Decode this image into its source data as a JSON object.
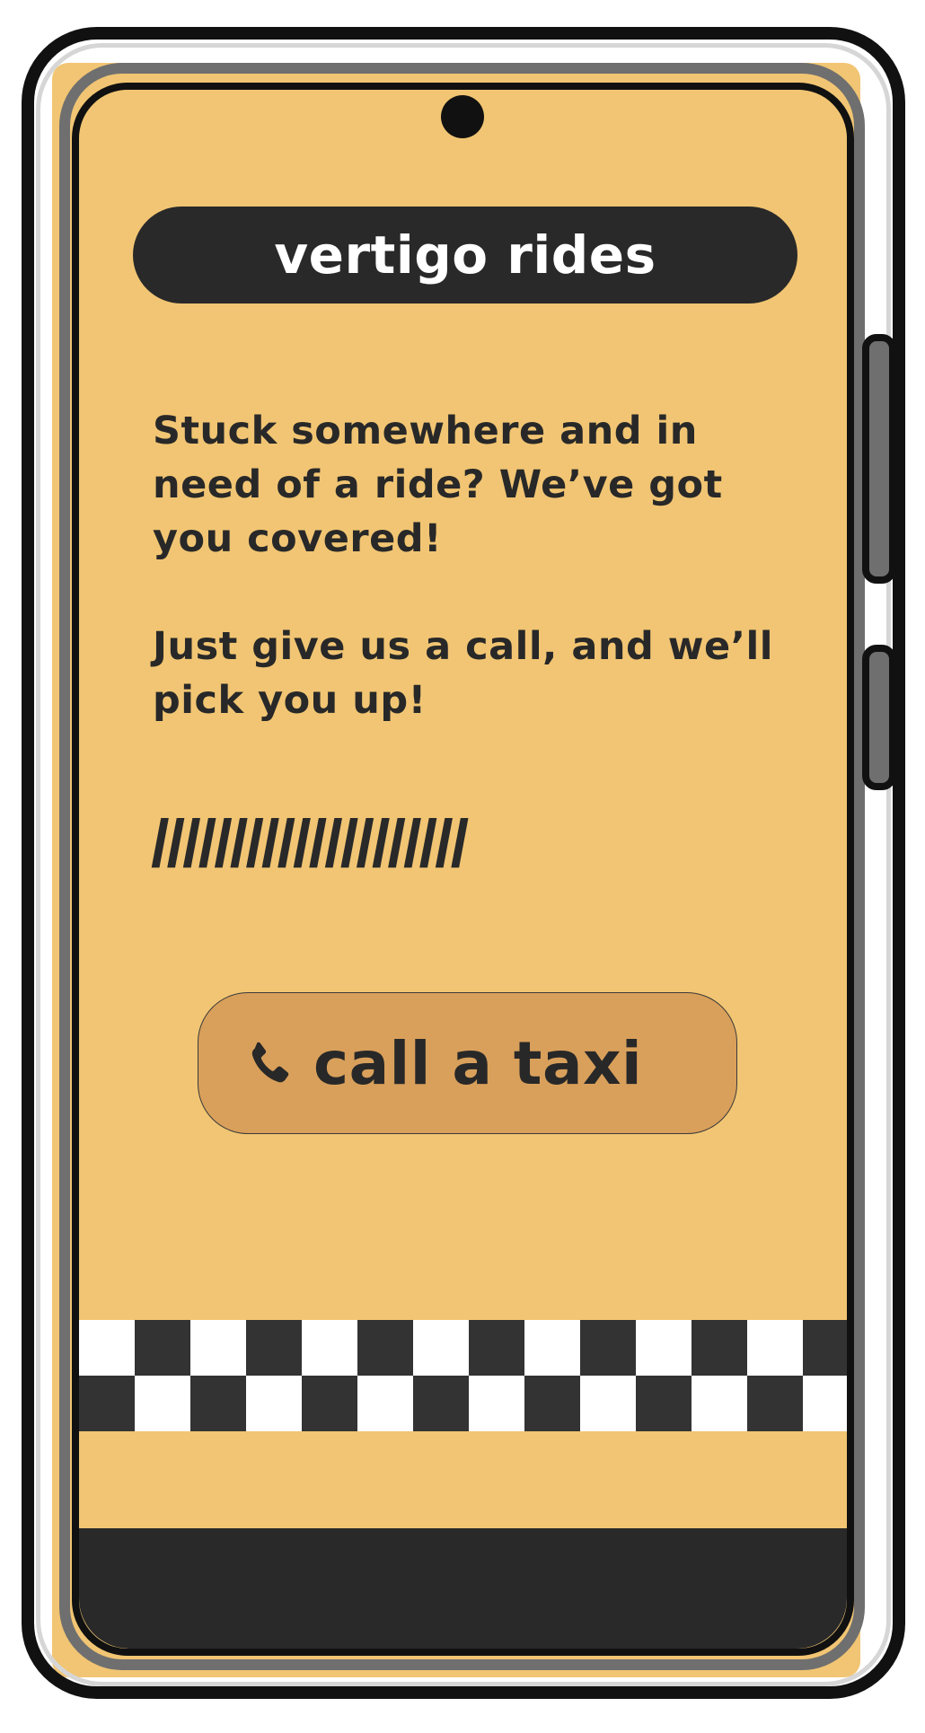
{
  "app": {
    "title": "vertigo rides"
  },
  "main": {
    "intro_text": "Stuck somewhere and in need of a ride? We’ve got you covered!",
    "call_text": "Just give us a call, and we’ll pick you up!",
    "divider_text": "////////////////////",
    "call_button": {
      "label": "call a taxi",
      "icon": "phone-icon"
    }
  },
  "colors": {
    "background": "#f1c573",
    "dark": "#292929",
    "button": "#d9a05b",
    "checker_dark": "#333333",
    "checker_light": "#ffffff"
  }
}
